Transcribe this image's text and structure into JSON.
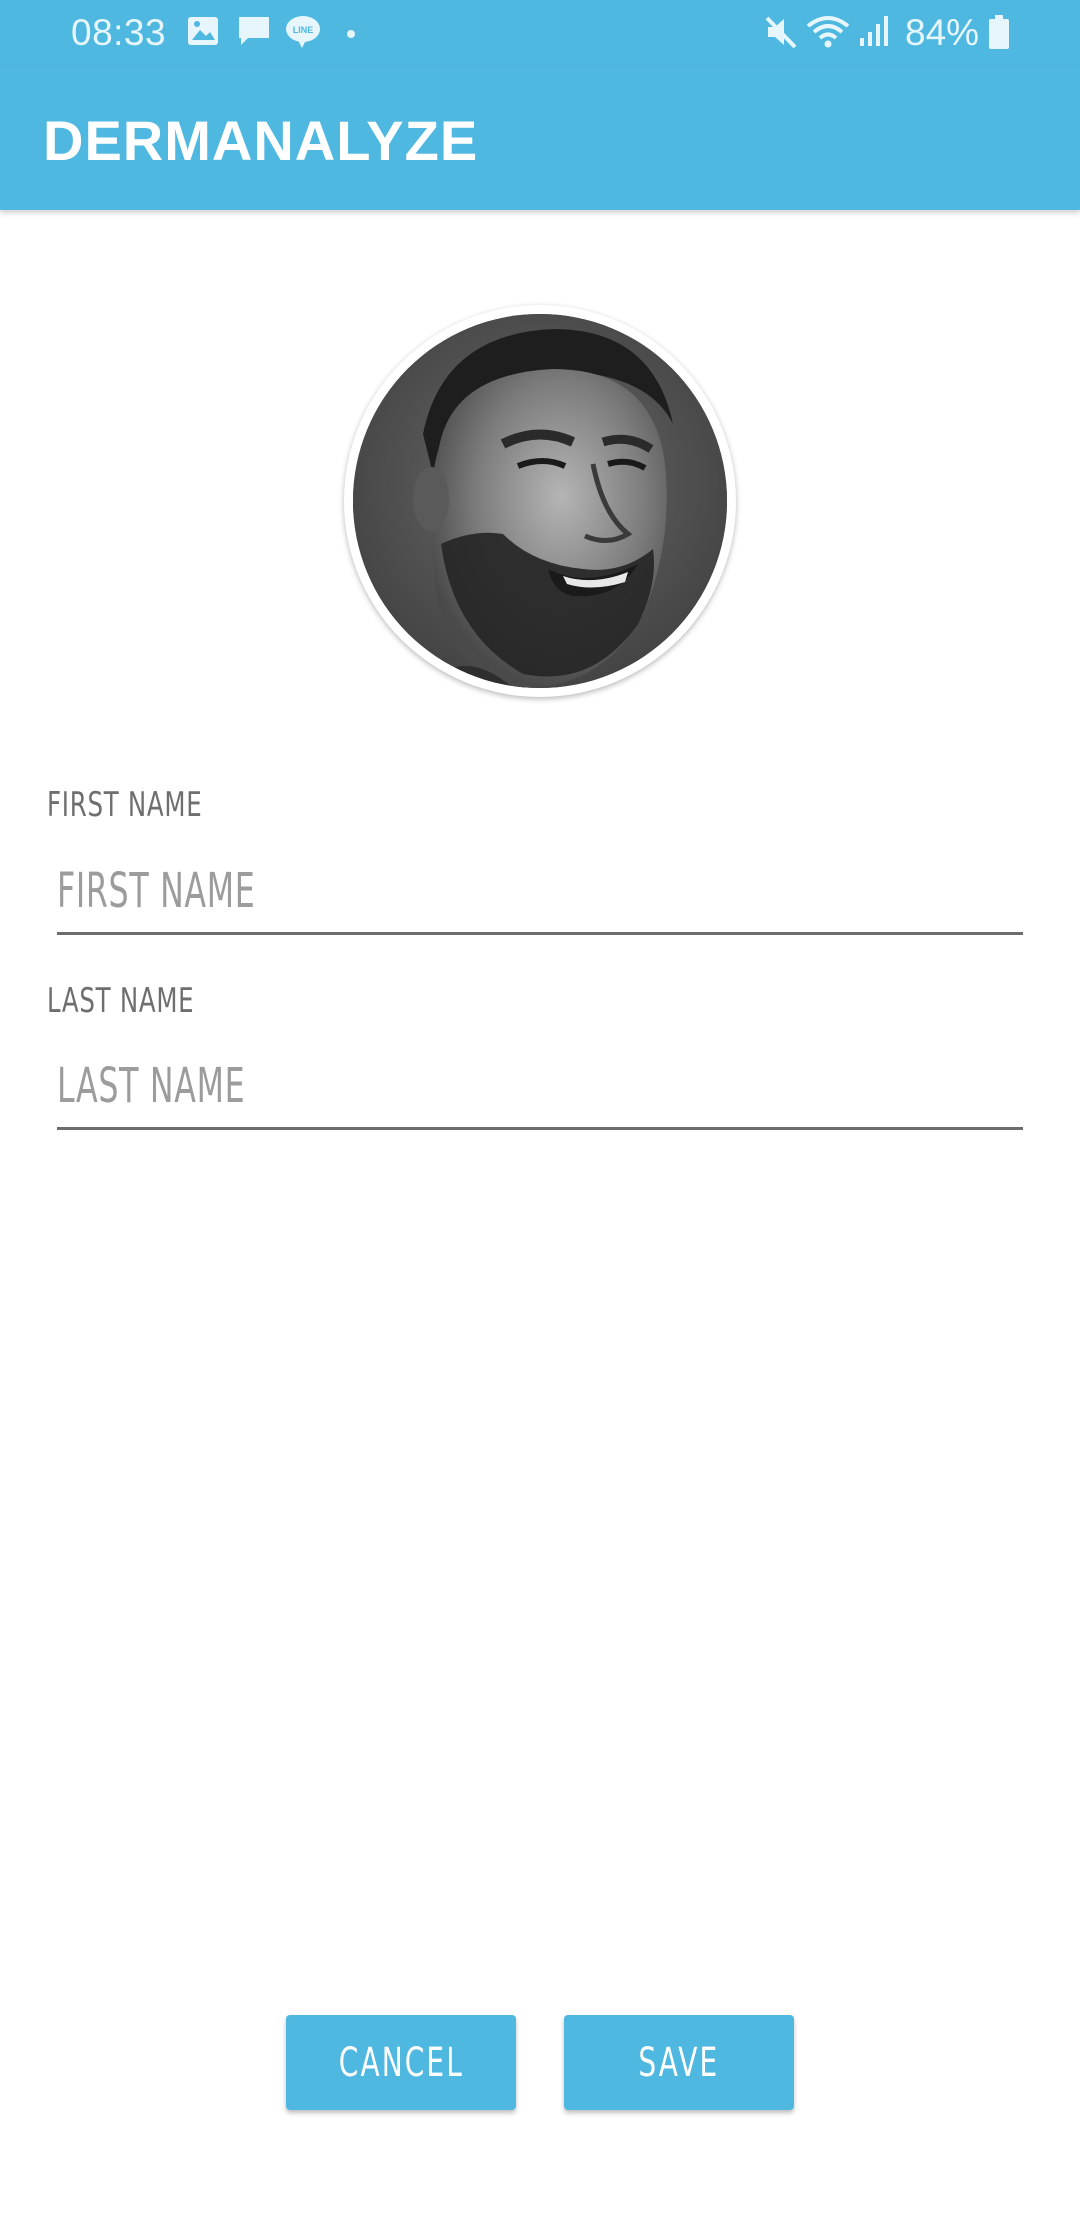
{
  "status_bar": {
    "time": "08:33",
    "battery": "84%",
    "left_icons": [
      "gallery-icon",
      "message-icon",
      "line-app-icon",
      "dot-icon"
    ],
    "right_icons": [
      "mute-icon",
      "wifi-icon",
      "signal-icon",
      "battery-icon"
    ]
  },
  "app_bar": {
    "title": "DERMANALYZE",
    "color": "#4fb8e0"
  },
  "profile": {
    "avatar": "profile-photo"
  },
  "form": {
    "first_name": {
      "label": "FIRST NAME",
      "placeholder": "FIRST NAME",
      "value": ""
    },
    "last_name": {
      "label": "LAST NAME",
      "placeholder": "LAST NAME",
      "value": ""
    }
  },
  "actions": {
    "cancel_label": "CANCEL",
    "save_label": "SAVE"
  }
}
